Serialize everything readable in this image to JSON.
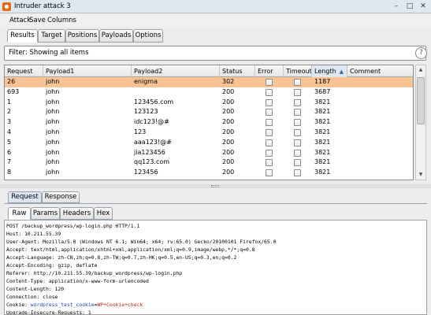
{
  "window": {
    "title": "Intruder attack 3",
    "controls": [
      "–",
      "□",
      "✕"
    ]
  },
  "menu": [
    "Attack",
    "Save",
    "Columns"
  ],
  "top_tabs": [
    {
      "label": "Results",
      "active": true
    },
    {
      "label": "Target",
      "active": false
    },
    {
      "label": "Positions",
      "active": false
    },
    {
      "label": "Payloads",
      "active": false
    },
    {
      "label": "Options",
      "active": false
    }
  ],
  "filter": {
    "text": "Filter: Showing all items",
    "help": "?"
  },
  "table": {
    "columns": [
      "Request",
      "Payload1",
      "Payload2",
      "Status",
      "Error",
      "Timeout",
      "Length",
      "Comment"
    ],
    "sorted_column": "Length",
    "sort_direction": "ascending",
    "rows": [
      {
        "request": "26",
        "payload1": "john",
        "payload2": "enigma",
        "status": "302",
        "error": false,
        "timeout": false,
        "length": "1187",
        "comment": "",
        "selected": true
      },
      {
        "request": "693",
        "payload1": "john",
        "payload2": "",
        "status": "200",
        "error": false,
        "timeout": false,
        "length": "3687",
        "comment": "",
        "selected": false
      },
      {
        "request": "1",
        "payload1": "john",
        "payload2": "123456.com",
        "status": "200",
        "error": false,
        "timeout": false,
        "length": "3821",
        "comment": "",
        "selected": false
      },
      {
        "request": "2",
        "payload1": "john",
        "payload2": "123123",
        "status": "200",
        "error": false,
        "timeout": false,
        "length": "3821",
        "comment": "",
        "selected": false
      },
      {
        "request": "3",
        "payload1": "john",
        "payload2": "idc123!@#",
        "status": "200",
        "error": false,
        "timeout": false,
        "length": "3821",
        "comment": "",
        "selected": false
      },
      {
        "request": "4",
        "payload1": "john",
        "payload2": "123",
        "status": "200",
        "error": false,
        "timeout": false,
        "length": "3821",
        "comment": "",
        "selected": false
      },
      {
        "request": "5",
        "payload1": "john",
        "payload2": "aaa123!@#",
        "status": "200",
        "error": false,
        "timeout": false,
        "length": "3821",
        "comment": "",
        "selected": false
      },
      {
        "request": "6",
        "payload1": "john",
        "payload2": "jia123456",
        "status": "200",
        "error": false,
        "timeout": false,
        "length": "3821",
        "comment": "",
        "selected": false
      },
      {
        "request": "7",
        "payload1": "john",
        "payload2": "qq123.com",
        "status": "200",
        "error": false,
        "timeout": false,
        "length": "3821",
        "comment": "",
        "selected": false
      },
      {
        "request": "8",
        "payload1": "john",
        "payload2": "123456",
        "status": "200",
        "error": false,
        "timeout": false,
        "length": "3821",
        "comment": "",
        "selected": false
      }
    ]
  },
  "detail_tabs": [
    {
      "label": "Request",
      "active": true
    },
    {
      "label": "Response",
      "active": false
    }
  ],
  "view_tabs": [
    {
      "label": "Raw",
      "active": true
    },
    {
      "label": "Params",
      "active": false
    },
    {
      "label": "Headers",
      "active": false
    },
    {
      "label": "Hex",
      "active": false
    }
  ],
  "raw_request": {
    "lines": [
      "POST /backup_wordpress/wp-login.php HTTP/1.1",
      "Host: 10.211.55.39",
      "User-Agent: Mozilla/5.0 (Windows NT 6.1; Win64; x64; rv:65.0) Gecko/20100101 Firefox/65.0",
      "Accept: text/html,application/xhtml+xml,application/xml;q=0.9,image/webp,*/*;q=0.8",
      "Accept-Language: zh-CN,zh;q=0.8,zh-TW;q=0.7,zh-HK;q=0.5,en-US;q=0.3,en;q=0.2",
      "Accept-Encoding: gzip, deflate",
      "Referer: http://10.211.55.39/backup_wordpress/wp-login.php",
      "Content-Type: application/x-www-form-urlencoded",
      "Content-Length: 120",
      "Connection: close"
    ],
    "cookie_prefix": "Cookie: ",
    "cookie_key": "wordpress_test_cookie",
    "cookie_eq": "=",
    "cookie_value": "WP+Cookie+check",
    "last_line": "Upgrade-Insecure-Requests: 1",
    "key_color": "#1b3fb0",
    "value_color": "#c11b1b"
  },
  "colors": {
    "selected_row": "#f9c495",
    "sorted_header": "#dde8f3",
    "app_icon": "#e36b1a"
  }
}
